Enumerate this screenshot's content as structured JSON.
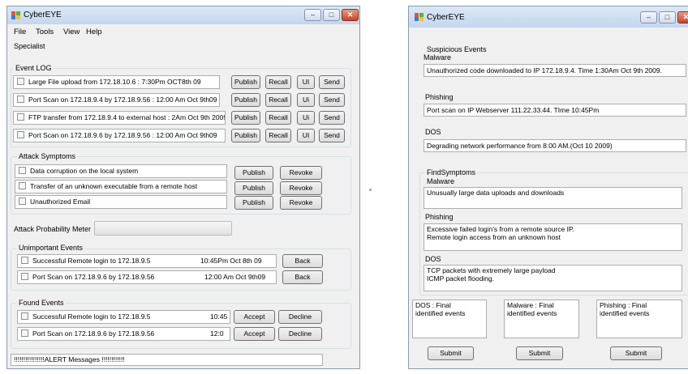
{
  "left_window": {
    "title": "CyberEYE",
    "controls": {
      "minimize": "–",
      "maximize": "□",
      "close": "✕"
    },
    "menu": [
      "File",
      "Tools",
      "View",
      "Help"
    ],
    "specialist_label": "Specialist",
    "event_log": {
      "label": "Event LOG",
      "rows": [
        {
          "text": "Large File upload from 172.18.10.6 : 7:30Pm OCT8th 09",
          "publish": "Publish",
          "recall": "Recall",
          "ui": "UI",
          "send": "Send"
        },
        {
          "text": "Port Scan on 172.18.9.4 by 172.18.9.56 : 12:00 Am Oct 9th09",
          "publish": "Publish",
          "recall": "Recall",
          "ui": "Ui",
          "send": "Send"
        },
        {
          "text": "FTP transfer from 172.18.9.4 to external host : 2Am Oct 9th 2009",
          "publish": "Publish",
          "recall": "Recall",
          "ui": "Ui",
          "send": "Send"
        },
        {
          "text": "Port Scan on 172.18.9.6 by 172.18.9.56 : 12:00 Am Oct 9th09",
          "publish": "Publish",
          "recall": "Recall",
          "ui": "UI",
          "send": "Send"
        }
      ]
    },
    "attack_symptoms": {
      "label": "Attack Symptoms",
      "rows": [
        {
          "text": "Data corruption on the local system",
          "publish": "Publish",
          "revoke": "Revoke"
        },
        {
          "text": "Transfer of an unknown executable from a remote host",
          "publish": "Publish",
          "revoke": "Revoke"
        },
        {
          "text": "Unauthorized Email",
          "publish": "Publish",
          "revoke": "Revoke"
        }
      ]
    },
    "meter": {
      "label": "Attack Probability Meter",
      "value": 0
    },
    "unimportant_events": {
      "label": "Unimportant Events",
      "rows": [
        {
          "text": "Successful Remote login to 172.18.9.5",
          "time": "10:45Pm Oct 8th 09",
          "back": "Back"
        },
        {
          "text": "Port Scan on 172.18.9.6 by 172.18.9.56",
          "time": "12:00 Am Oct 9th09",
          "back": "Back"
        }
      ]
    },
    "found_events": {
      "label": "Found Events",
      "rows": [
        {
          "text": "Successful Remote login to 172.18.9.5",
          "time": "10:45",
          "accept": "Accept",
          "decline": "Decline"
        },
        {
          "text": "Port Scan on 172.18.9.6 by 172.18.9.56",
          "time": "12:0",
          "accept": "Accept",
          "decline": "Decline"
        }
      ]
    },
    "alert_text": "!!!!!!!!!!!!!!!!ALERT Messages !!!!!!!!!!!!"
  },
  "right_window": {
    "title": "CyberEYE",
    "controls": {
      "minimize": "–",
      "maximize": "□",
      "close": "✕"
    },
    "suspicious": {
      "label": "Suspicious Events",
      "malware_label": "Malware",
      "malware_value": "Unauthorized code downloaded to IP 172.18.9.4. Time 1:30Am Oct 9th 2009.",
      "phishing_label": "Phishing",
      "phishing_value": "Port scan on IP Webserver 111.22.33.44. TIme 10:45Pm",
      "dos_label": "DOS",
      "dos_value": "Degrading network performance from 8:00 AM.(Oct 10 2009)"
    },
    "find_symptoms": {
      "label": "FindSymptoms",
      "malware_label": "Malware",
      "malware_value": "Unusually large data uploads and downloads",
      "phishing_label": "Phishing",
      "phishing_value": "Excessive failed login's from a remote source IP.\nRemote login access from an unknown host",
      "dos_label": "DOS",
      "dos_value": "TCP packets with extremely large payload\nICMP packet flooding."
    },
    "finals": [
      {
        "text": "DOS : Final\nidentified events",
        "submit": "Submit"
      },
      {
        "text": "Malware : Final\nidentified events",
        "submit": "Submit"
      },
      {
        "text": "Phishing : Final\nidentified events",
        "submit": "Submit"
      }
    ]
  }
}
